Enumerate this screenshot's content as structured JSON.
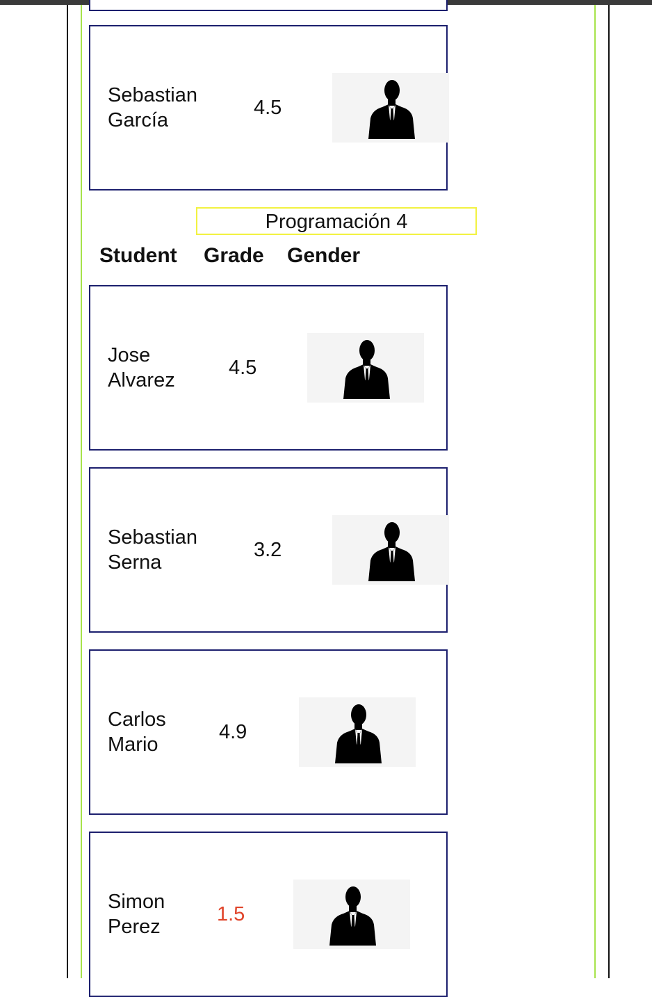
{
  "section": {
    "title": "Programación 4",
    "headers": {
      "student": "Student",
      "grade": "Grade",
      "gender": "Gender"
    }
  },
  "previous_student": {
    "first": "Sebastian",
    "last": "García",
    "grade": "4.5",
    "gender_icon": "male-silhouette-icon"
  },
  "students": [
    {
      "first": "Jose",
      "last": "Alvarez",
      "grade": "4.5",
      "gender_icon": "male-silhouette-icon"
    },
    {
      "first": "Sebastian",
      "last": "Serna",
      "grade": "3.2",
      "gender_icon": "male-silhouette-icon"
    },
    {
      "first": "Carlos",
      "last": "Mario",
      "grade": "4.9",
      "gender_icon": "male-silhouette-icon"
    },
    {
      "first": "Simon",
      "last": "Perez",
      "grade": "1.5",
      "gender_icon": "male-silhouette-icon",
      "grade_color": "#e0442a"
    }
  ],
  "colors": {
    "card_border": "#1c1f6e",
    "title_border": "#f2f241",
    "frame_green": "#a6e34a",
    "failing_grade": "#e0442a"
  }
}
